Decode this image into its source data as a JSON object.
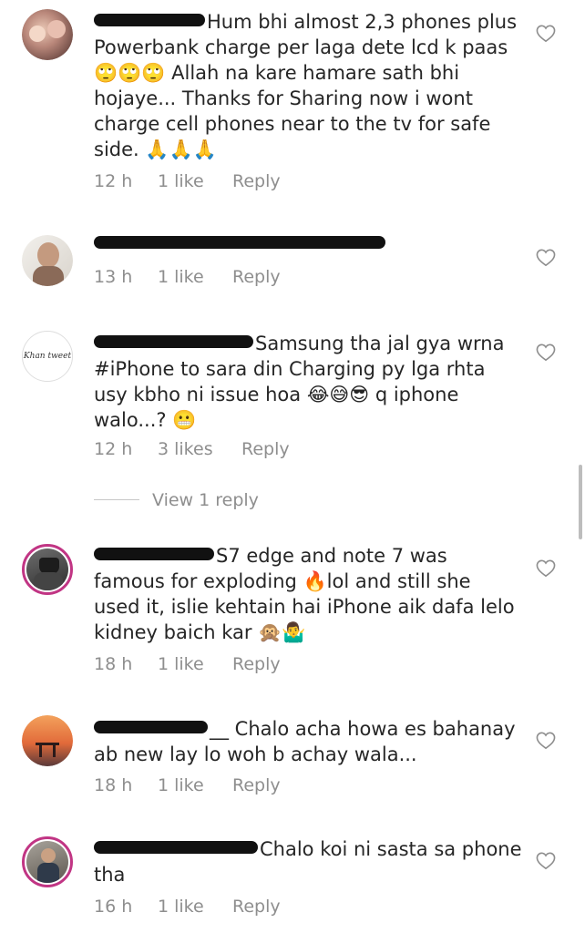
{
  "comments": [
    {
      "text": "Hum bhi almost 2,3 phones plus Powerbank charge per laga dete lcd k paas 🙄🙄🙄 Allah na kare hamare sath bhi hojaye... Thanks for Sharing now i wont charge cell phones near to the tv for safe side. 🙏🙏🙏",
      "time": "12 h",
      "likes": "1 like",
      "reply": "Reply"
    },
    {
      "text": "",
      "time": "13 h",
      "likes": "1 like",
      "reply": "Reply"
    },
    {
      "avatar_text": "Khan tweet",
      "text": "Samsung tha jal gya wrna #iPhone to sara din Charging py lga rhta usy kbho ni issue hoa 😂😅😎 q iphone walo...? 😬",
      "time": "12 h",
      "likes": "3 likes",
      "reply": "Reply",
      "view_replies": "View 1 reply"
    },
    {
      "text": "S7 edge and note 7 was famous for exploding 🔥lol and still she used it, islie kehtain hai iPhone aik dafa lelo kidney baich kar 🙊🤷‍♂️",
      "time": "18 h",
      "likes": "1 like",
      "reply": "Reply"
    },
    {
      "text": "__ Chalo acha howa es bahanay ab new lay lo woh b achay wala...",
      "time": "18 h",
      "likes": "1 like",
      "reply": "Reply"
    },
    {
      "text": "Chalo koi ni sasta sa phone tha",
      "time": "16 h",
      "likes": "1 like",
      "reply": "Reply"
    }
  ],
  "icons": {
    "like": "heart-outline-icon"
  },
  "colors": {
    "text": "#262626",
    "meta": "#8e8e8e",
    "story_ring": "#c13584"
  }
}
